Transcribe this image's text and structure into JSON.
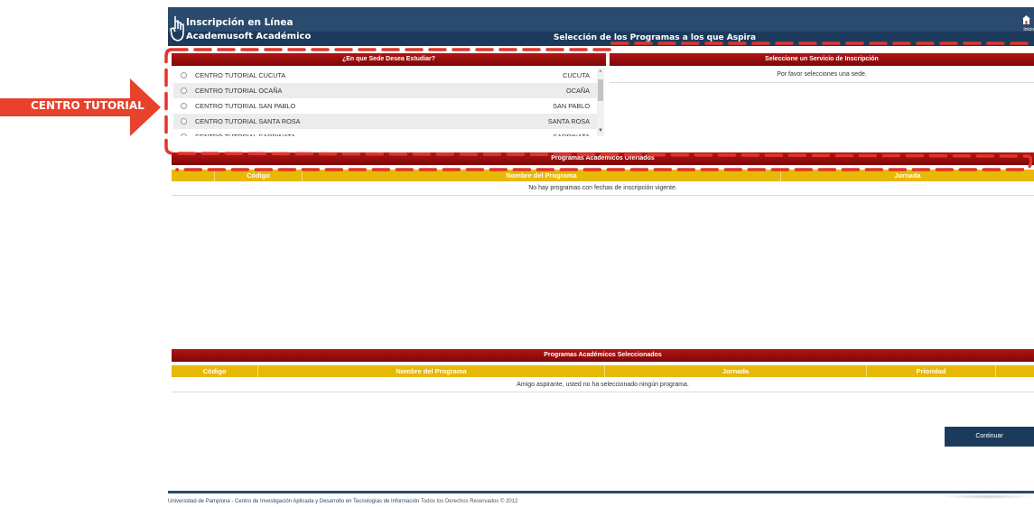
{
  "header": {
    "brand_title": "Inscripción en Línea",
    "brand_subtitle": "Academusoft Académico",
    "page_title": "Selección de los Programas a los que Aspira",
    "home_label": "Inicio",
    "colors": {
      "header": "#2a4a6e",
      "red": "#b41414",
      "yellow": "#e8b806"
    }
  },
  "annotation": {
    "label": "CENTRO TUTORIAL",
    "color": "#e8412c"
  },
  "sede_panel": {
    "title": "¿En que Sede Desea Estudiar?",
    "items": [
      {
        "name": "CENTRO TUTORIAL CUCUTA",
        "city": "CUCUTA"
      },
      {
        "name": "CENTRO TUTORIAL OCAÑA",
        "city": "OCAÑA"
      },
      {
        "name": "CENTRO TUTORIAL SAN PABLO",
        "city": "SAN PABLO"
      },
      {
        "name": "CENTRO TUTORIAL SANTA ROSA",
        "city": "SANTA ROSA"
      },
      {
        "name": "CENTRO TUTORIAL SARDINATA",
        "city": "SARDINATA"
      }
    ]
  },
  "servicio_panel": {
    "title": "Seleccione un Servicio de Inscripción",
    "message": "Por favor selecciones una sede."
  },
  "ofertados": {
    "title": "Programas Académicos Ofertados",
    "columns": [
      "Código",
      "Nombre del Programa",
      "Jornada"
    ],
    "empty_message": "No hay programas con fechas de inscripción vigente."
  },
  "seleccionados": {
    "title": "Programas Académicos Seleccionados",
    "columns": [
      "Código",
      "Nombre del Programa",
      "Jornada",
      "Prioridad"
    ],
    "empty_message": "Amigo aspirante, usted no ha seleccionado ningún programa."
  },
  "continue_label": "Continuar",
  "footer": {
    "bold": "Universidad de Pamplona - Centro de Investigación Aplicada y Desarrollo en Tecnologías de Información",
    "rest": " Todos los Derechos Reservados © 2012"
  }
}
